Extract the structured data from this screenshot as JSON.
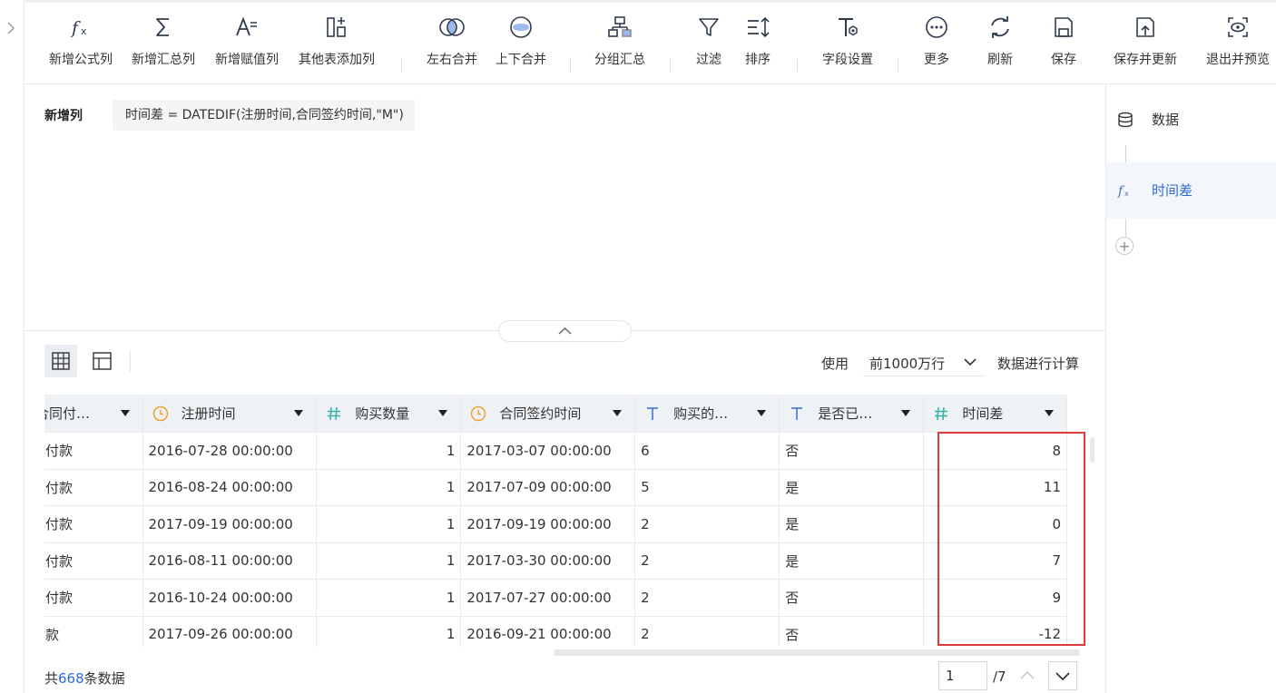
{
  "toolbar": {
    "items": [
      {
        "label": "新增公式列",
        "icon": "fx-icon"
      },
      {
        "label": "新增汇总列",
        "icon": "sigma-icon"
      },
      {
        "label": "新增赋值列",
        "icon": "assign-icon"
      },
      {
        "label": "其他表添加列",
        "icon": "add-column-icon"
      },
      {
        "label": "左右合并",
        "icon": "join-horizontal-icon"
      },
      {
        "label": "上下合并",
        "icon": "union-vertical-icon"
      },
      {
        "label": "分组汇总",
        "icon": "group-icon"
      },
      {
        "label": "过滤",
        "icon": "filter-icon"
      },
      {
        "label": "排序",
        "icon": "sort-icon"
      },
      {
        "label": "字段设置",
        "icon": "field-settings-icon"
      },
      {
        "label": "更多",
        "icon": "more-icon"
      },
      {
        "label": "刷新",
        "icon": "refresh-icon"
      },
      {
        "label": "保存",
        "icon": "save-icon"
      },
      {
        "label": "保存并更新",
        "icon": "save-update-icon"
      },
      {
        "label": "退出并预览",
        "icon": "exit-preview-icon"
      }
    ]
  },
  "formula": {
    "section_label": "新增列",
    "expression": "时间差 = DATEDIF(注册时间,合同签约时间,\"M\")"
  },
  "right_panel": {
    "steps": [
      {
        "label": "数据",
        "icon": "database-icon"
      },
      {
        "label": "时间差",
        "icon": "fx-icon"
      }
    ],
    "add_icon": "plus-icon"
  },
  "data_controls": {
    "use_label": "使用",
    "rows_option": "前1000万行",
    "calc_label": "数据进行计算"
  },
  "table": {
    "columns": [
      {
        "label": "合同付…",
        "type": "text",
        "type_icon": ""
      },
      {
        "label": "注册时间",
        "type": "date",
        "type_icon": "clock-icon"
      },
      {
        "label": "购买数量",
        "type": "number",
        "type_icon": "hash-icon"
      },
      {
        "label": "合同签约时间",
        "type": "date",
        "type_icon": "clock-icon"
      },
      {
        "label": "购买的…",
        "type": "text",
        "type_icon": "text-t-icon"
      },
      {
        "label": "是否已…",
        "type": "text",
        "type_icon": "text-t-icon"
      },
      {
        "label": "时间差",
        "type": "number",
        "type_icon": "hash-icon"
      }
    ],
    "rows": [
      [
        "已付款",
        "2016-07-28 00:00:00",
        "1",
        "2017-03-07 00:00:00",
        "6",
        "否",
        "8"
      ],
      [
        "已付款",
        "2016-08-24 00:00:00",
        "1",
        "2017-07-09 00:00:00",
        "5",
        "是",
        "11"
      ],
      [
        "已付款",
        "2017-09-19 00:00:00",
        "1",
        "2017-09-19 00:00:00",
        "2",
        "是",
        "0"
      ],
      [
        "已付款",
        "2016-08-11 00:00:00",
        "1",
        "2017-03-30 00:00:00",
        "2",
        "是",
        "7"
      ],
      [
        "已付款",
        "2016-10-24 00:00:00",
        "1",
        "2017-07-27 00:00:00",
        "2",
        "否",
        "9"
      ],
      [
        "付款",
        "2017-09-26 00:00:00",
        "1",
        "2016-09-21 00:00:00",
        "2",
        "否",
        "-12"
      ]
    ]
  },
  "footer": {
    "total_prefix": "共",
    "total_count": "668",
    "total_suffix": "条数据",
    "page_value": "1",
    "page_total": "/7"
  },
  "colors": {
    "accent": "#2e6ad6",
    "highlight": "#e23a3a",
    "header_bg": "#eff2f5",
    "icon_orange": "#f0a030",
    "icon_teal": "#36b3a8",
    "icon_blue": "#4a7de0"
  }
}
